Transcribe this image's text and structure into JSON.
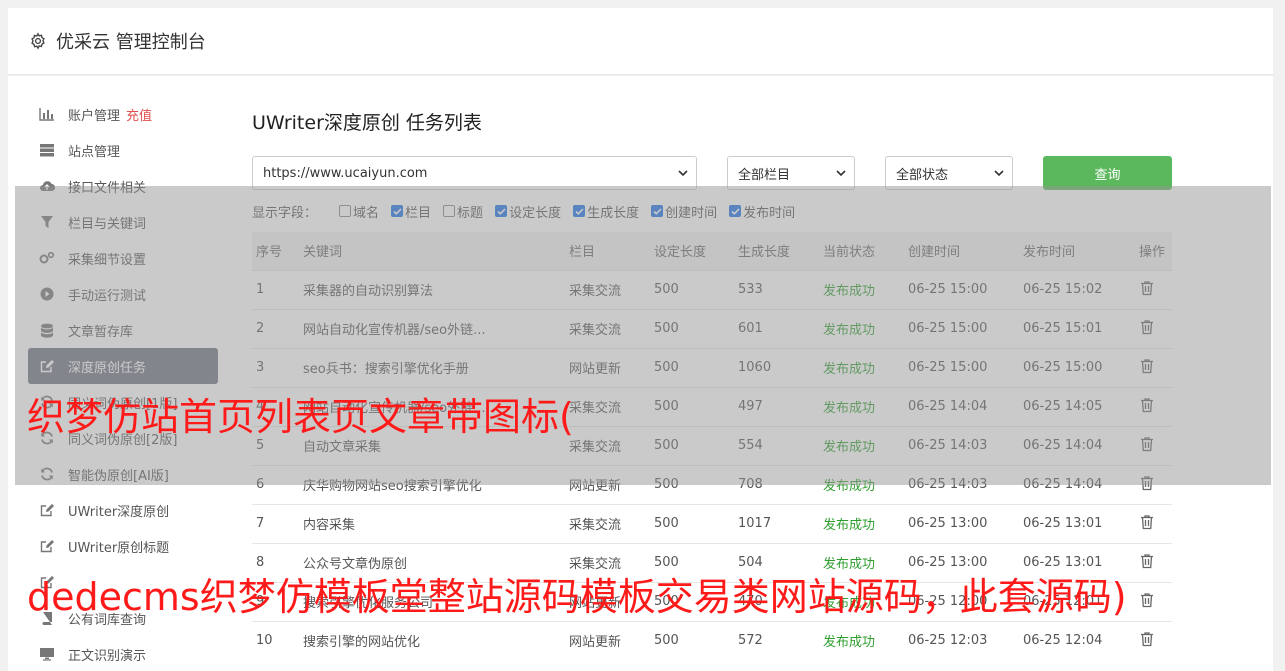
{
  "header": {
    "title": "优采云 管理控制台",
    "icon": "gear-icon"
  },
  "sidebar": {
    "items": [
      {
        "label": "账户管理",
        "badge": "充值",
        "icon": "bar-chart-icon"
      },
      {
        "label": "站点管理",
        "icon": "server-icon"
      },
      {
        "label": "接口文件相关",
        "icon": "cloud-upload-icon"
      },
      {
        "label": "栏目与关键词",
        "icon": "filter-icon"
      },
      {
        "label": "采集细节设置",
        "icon": "cogs-icon"
      },
      {
        "label": "手动运行测试",
        "icon": "play-circle-icon"
      },
      {
        "label": "文章暂存库",
        "icon": "database-icon"
      },
      {
        "label": "深度原创任务",
        "icon": "edit-icon",
        "active": true
      },
      {
        "label": "同义词伪原创[1版]",
        "icon": "refresh-icon"
      },
      {
        "label": "同义词伪原创[2版]",
        "icon": "refresh-icon"
      },
      {
        "label": "智能伪原创[AI版]",
        "icon": "refresh-icon"
      },
      {
        "label": "UWriter深度原创",
        "icon": "edit-icon"
      },
      {
        "label": "UWriter原创标题",
        "icon": "edit-icon"
      },
      {
        "label": "",
        "icon": "edit-icon"
      },
      {
        "label": "公有词库查询",
        "icon": "book-icon"
      },
      {
        "label": "正文识别演示",
        "icon": "monitor-icon"
      }
    ]
  },
  "main": {
    "title": "UWriter深度原创 任务列表",
    "site_select": "https://www.ucaiyun.com",
    "column_select": "全部栏目",
    "status_select": "全部状态",
    "query_button": "查询",
    "fields_label": "显示字段：",
    "fields": [
      {
        "label": "域名",
        "checked": false
      },
      {
        "label": "栏目",
        "checked": true
      },
      {
        "label": "标题",
        "checked": false
      },
      {
        "label": "设定长度",
        "checked": true
      },
      {
        "label": "生成长度",
        "checked": true
      },
      {
        "label": "创建时间",
        "checked": true
      },
      {
        "label": "发布时间",
        "checked": true
      }
    ],
    "table": {
      "headers": [
        "序号",
        "关键词",
        "栏目",
        "设定长度",
        "生成长度",
        "当前状态",
        "创建时间",
        "发布时间",
        "操作"
      ],
      "rows": [
        [
          "1",
          "采集器的自动识别算法",
          "采集交流",
          "500",
          "533",
          "发布成功",
          "06-25 15:00",
          "06-25 15:02"
        ],
        [
          "2",
          "网站自动化宣传机器/seo外链...",
          "采集交流",
          "500",
          "601",
          "发布成功",
          "06-25 15:00",
          "06-25 15:01"
        ],
        [
          "3",
          "seo兵书：搜索引擎优化手册",
          "网站更新",
          "500",
          "1060",
          "发布成功",
          "06-25 15:00",
          "06-25 15:00"
        ],
        [
          "4",
          "网站自动化宣传机器/seo外链...",
          "采集交流",
          "500",
          "497",
          "发布成功",
          "06-25 14:04",
          "06-25 14:05"
        ],
        [
          "5",
          "自动文章采集",
          "采集交流",
          "500",
          "554",
          "发布成功",
          "06-25 14:03",
          "06-25 14:04"
        ],
        [
          "6",
          "庆华购物网站seo搜索引擎优化",
          "网站更新",
          "500",
          "708",
          "发布成功",
          "06-25 14:03",
          "06-25 14:04"
        ],
        [
          "7",
          "内容采集",
          "采集交流",
          "500",
          "1017",
          "发布成功",
          "06-25 13:00",
          "06-25 13:01"
        ],
        [
          "8",
          "公众号文章伪原创",
          "采集交流",
          "500",
          "504",
          "发布成功",
          "06-25 13:00",
          "06-25 13:01"
        ],
        [
          "9",
          "搜索引擎优化服务公司",
          "网站更新",
          "500",
          "470",
          "发布成功",
          "06-25 12:00",
          "06-25 12:01"
        ],
        [
          "10",
          "搜索引擎的网站优化",
          "网站更新",
          "500",
          "572",
          "发布成功",
          "06-25 12:03",
          "06-25 12:04"
        ]
      ]
    }
  },
  "watermark": {
    "line1": "织梦仿站首页列表页文章带图标(",
    "line2": "dedecms织梦仿模板堂整站源码模板交易类网站源码，此套源码)"
  }
}
